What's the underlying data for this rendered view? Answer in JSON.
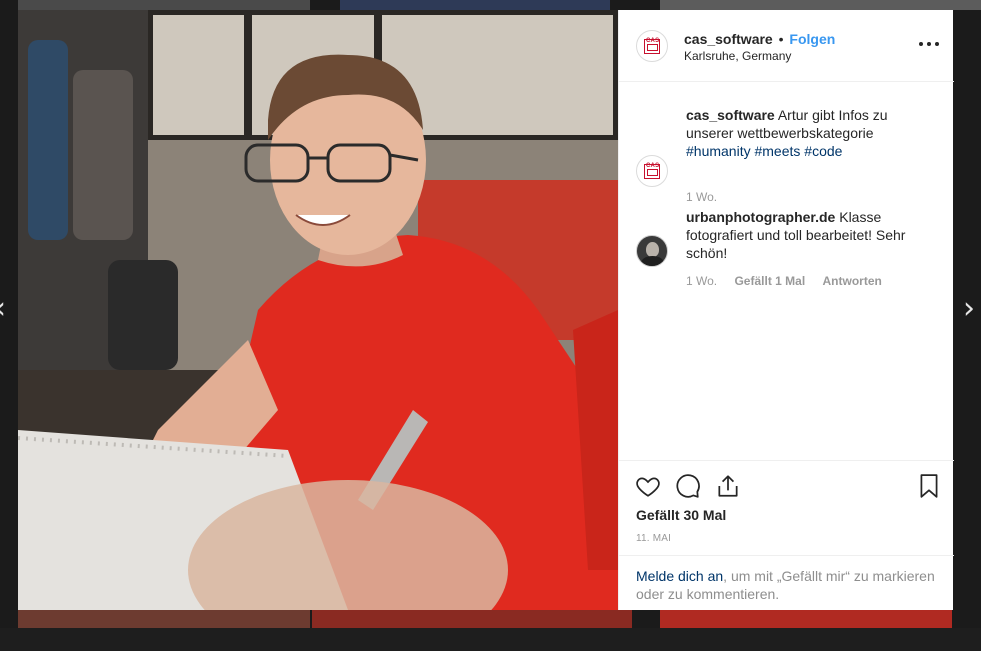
{
  "post": {
    "username": "cas_software",
    "separator": "•",
    "follow_label": "Folgen",
    "location": "Karlsruhe, Germany",
    "avatar_text": "CAS"
  },
  "caption": {
    "username": "cas_software",
    "text": "Artur gibt Infos zu unserer wettbewerbskategorie",
    "hashtags": [
      "#humanity",
      "#meets",
      "#code"
    ],
    "time": "1 Wo."
  },
  "comments": [
    {
      "username": "urbanphotographer.de",
      "text": "Klasse fotografiert und toll bearbeitet! Sehr schön!",
      "time": "1 Wo.",
      "likes": "Gefällt 1 Mal",
      "reply_label": "Antworten"
    }
  ],
  "actions": {
    "like_icon": "heart-icon",
    "comment_icon": "comment-bubble-icon",
    "share_icon": "share-icon",
    "save_icon": "bookmark-icon"
  },
  "likes_text": "Gefällt 30 Mal",
  "date_text": "11. MAI",
  "login_prompt": {
    "link_text": "Melde dich an",
    "rest_text": ", um mit „Gefällt mir“ zu markieren oder zu kommentieren."
  },
  "navigation": {
    "prev_glyph": "‹",
    "next_glyph": "›"
  },
  "colors": {
    "link_blue": "#3897f0",
    "hashtag_navy": "#003569",
    "brand_red": "#c8102e",
    "shirt_red": "#e02a1f"
  }
}
